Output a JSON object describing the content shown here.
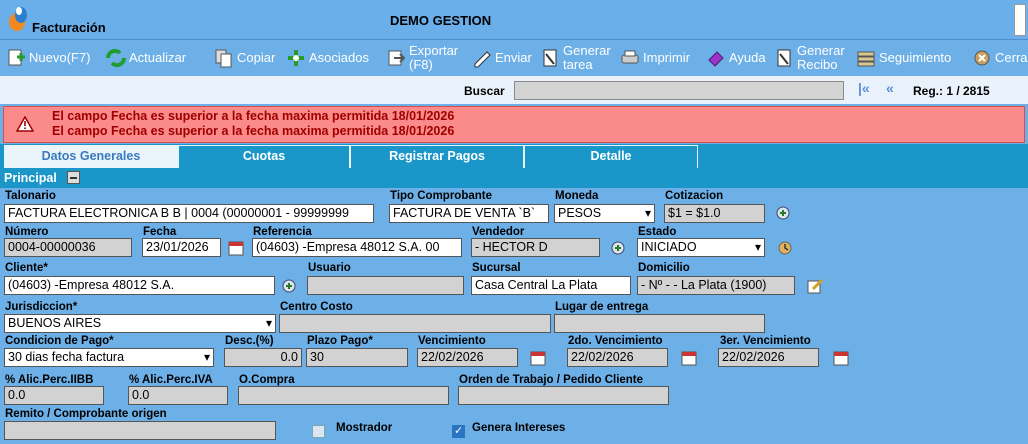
{
  "app": {
    "title": "Facturación",
    "company": "DEMO GESTION"
  },
  "toolbar": [
    {
      "label": "Nuevo(F7)",
      "icon": "new-doc-icon"
    },
    {
      "label": "Actualizar",
      "icon": "refresh-icon"
    },
    {
      "label": "Copiar",
      "icon": "copy-icon"
    },
    {
      "label": "Asociados",
      "icon": "linked-docs-icon"
    },
    {
      "label": "Exportar (F8)",
      "icon": "export-icon"
    },
    {
      "label": "Enviar",
      "icon": "send-icon"
    },
    {
      "label": "Generar tarea",
      "icon": "task-icon"
    },
    {
      "label": "Imprimir",
      "icon": "print-icon"
    },
    {
      "label": "Ayuda",
      "icon": "help-book-icon"
    },
    {
      "label": "Generar Recibo",
      "icon": "receipt-icon"
    },
    {
      "label": "Seguimiento",
      "icon": "tracking-icon"
    },
    {
      "label": "Cerra",
      "icon": "close-icon"
    }
  ],
  "search": {
    "label": "Buscar",
    "value": "",
    "first": "|«",
    "prev": "«",
    "reg_label": "Reg.: 1 / 2815"
  },
  "alerts": [
    "El campo Fecha es superior a la fecha maxima permitida 18/01/2026",
    "El campo Fecha es superior a la fecha maxima permitida 18/01/2026"
  ],
  "tabs": [
    "Datos Generales",
    "Cuotas",
    "Registrar Pagos",
    "Detalle"
  ],
  "section": {
    "title": "Principal"
  },
  "form": {
    "talonario": {
      "label": "Talonario",
      "value": "FACTURA ELECTRONICA B B | 0004 (00000001 - 99999999"
    },
    "tipo_comprobante": {
      "label": "Tipo Comprobante",
      "value": "FACTURA DE VENTA `B`"
    },
    "moneda": {
      "label": "Moneda",
      "value": "PESOS"
    },
    "cotizacion": {
      "label": "Cotizacion",
      "value": "$1 = $1.0"
    },
    "numero": {
      "label": "Número",
      "value": "0004-00000036"
    },
    "fecha": {
      "label": "Fecha",
      "value": "23/01/2026"
    },
    "referencia": {
      "label": "Referencia",
      "value": "(04603) -Empresa 48012 S.A. 00"
    },
    "vendedor": {
      "label": "Vendedor",
      "value": "- HECTOR D"
    },
    "estado": {
      "label": "Estado",
      "value": "INICIADO"
    },
    "cliente": {
      "label": "Cliente*",
      "value": "(04603) -Empresa 48012 S.A."
    },
    "usuario": {
      "label": "Usuario",
      "value": ""
    },
    "sucursal": {
      "label": "Sucursal",
      "value": "Casa Central La Plata"
    },
    "domicilio": {
      "label": "Domicilio",
      "value": "- Nº - - La Plata (1900)"
    },
    "jurisdiccion": {
      "label": "Jurisdiccion*",
      "value": "BUENOS AIRES"
    },
    "centro_costo": {
      "label": "Centro Costo",
      "value": ""
    },
    "lugar_entrega": {
      "label": "Lugar de entrega",
      "value": ""
    },
    "condicion_pago": {
      "label": "Condicion de Pago*",
      "value": "30 dias fecha factura"
    },
    "desc": {
      "label": "Desc.(%)",
      "value": "0.0"
    },
    "plazo_pago": {
      "label": "Plazo Pago*",
      "value": "30"
    },
    "vencimiento": {
      "label": "Vencimiento",
      "value": "22/02/2026"
    },
    "vencimiento2": {
      "label": "2do. Vencimiento",
      "value": "22/02/2026"
    },
    "vencimiento3": {
      "label": "3er. Vencimiento",
      "value": "22/02/2026"
    },
    "alic_iibb": {
      "label": "% Alic.Perc.IIBB",
      "value": "0.0"
    },
    "alic_iva": {
      "label": "% Alic.Perc.IVA",
      "value": "0.0"
    },
    "o_compra": {
      "label": "O.Compra",
      "value": ""
    },
    "orden_trabajo": {
      "label": "Orden de Trabajo / Pedido Cliente",
      "value": ""
    },
    "remito": {
      "label": "Remito / Comprobante origen",
      "value": ""
    },
    "mostrador": {
      "label": "Mostrador",
      "checked": false
    },
    "genera_intereses": {
      "label": "Genera Intereses",
      "checked": true
    }
  },
  "colors": {
    "background": "#6db0e8",
    "tab_bar": "#1a97c8",
    "alert_bg": "#fb8a8a",
    "alert_text": "#a00000"
  }
}
